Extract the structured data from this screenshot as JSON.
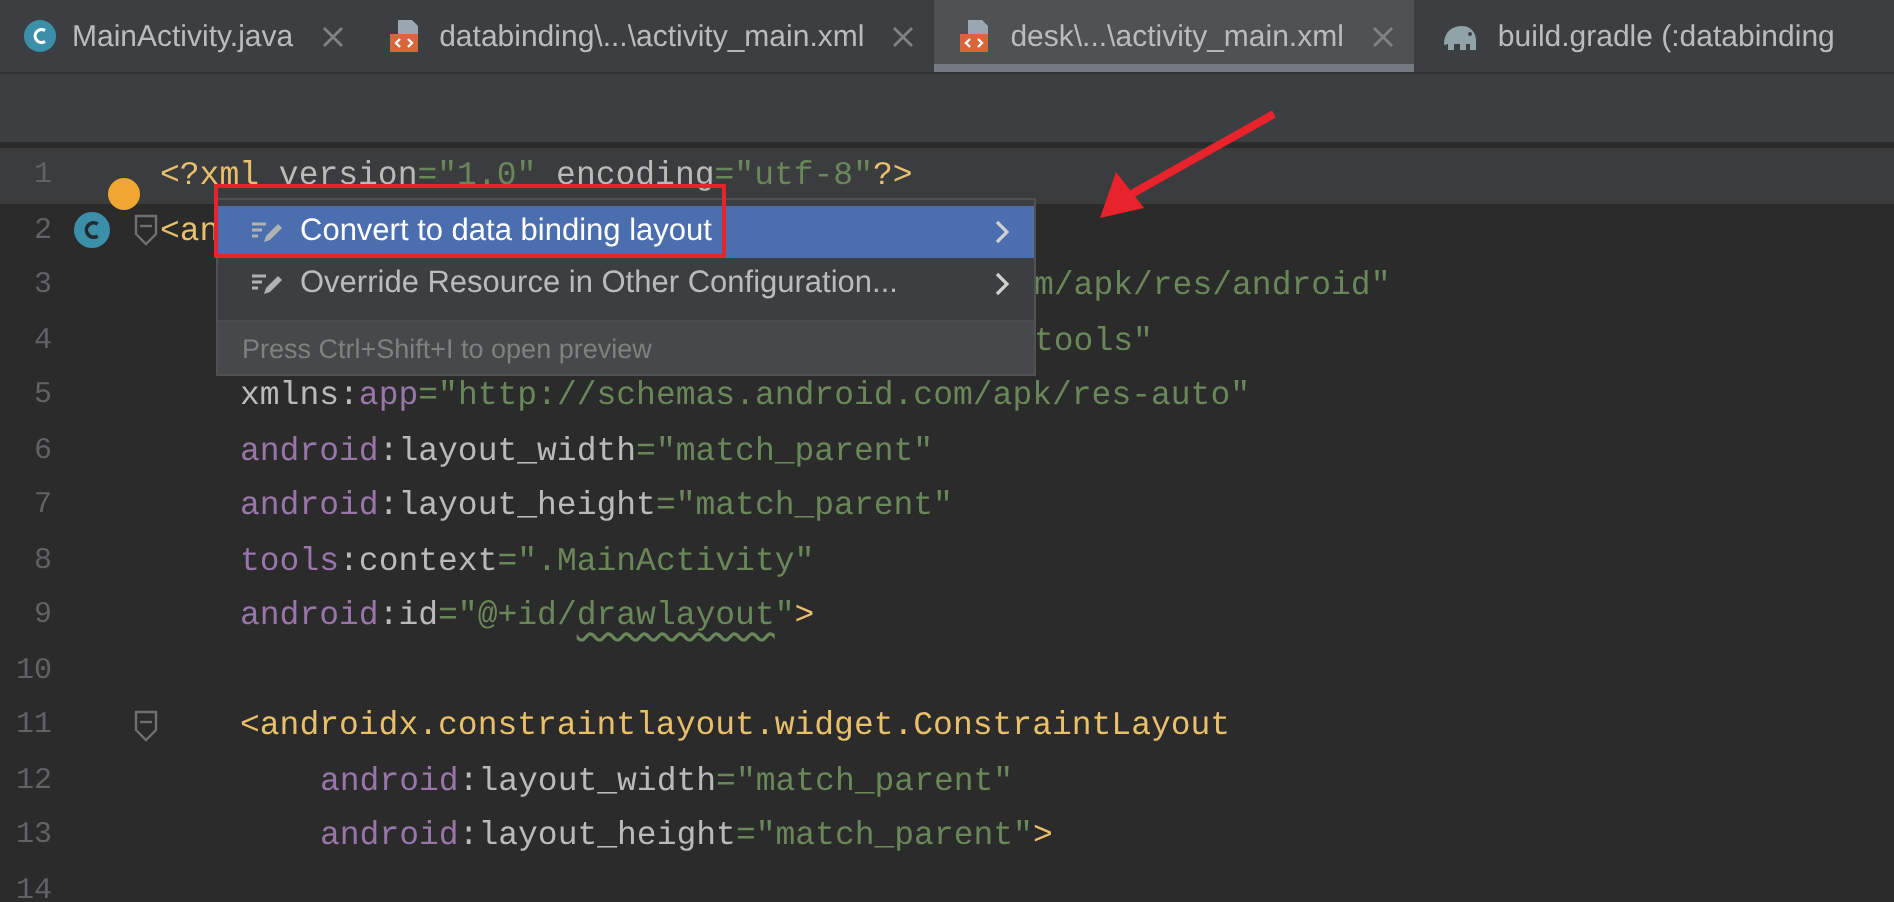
{
  "tabs": [
    {
      "label": "MainActivity.java",
      "kind": "java",
      "selected": false,
      "closable": true
    },
    {
      "label": "databinding\\...\\activity_main.xml",
      "kind": "xml",
      "selected": false,
      "closable": true
    },
    {
      "label": "desk\\...\\activity_main.xml",
      "kind": "xml",
      "selected": true,
      "closable": true
    },
    {
      "label": "build.gradle (:databinding",
      "kind": "gradle",
      "selected": false,
      "closable": false
    }
  ],
  "editor": {
    "lines": [
      {
        "number": "1",
        "current": true,
        "tokens": [
          {
            "kind": "tag",
            "text": "<?xml "
          },
          {
            "kind": "attr",
            "text": "version"
          },
          {
            "kind": "str",
            "text": "=\"1.0\" "
          },
          {
            "kind": "attr",
            "text": "encoding"
          },
          {
            "kind": "str",
            "text": "=\"utf-8\""
          },
          {
            "kind": "tag",
            "text": "?>"
          }
        ]
      },
      {
        "number": "2",
        "class_marker": true,
        "fold": true,
        "bulb": true,
        "tokens": [
          {
            "kind": "tag",
            "text": "<an"
          }
        ]
      },
      {
        "number": "3",
        "kind": "covered",
        "tokens": [
          {
            "kind": "str",
            "text": "m/apk/res/android\""
          }
        ]
      },
      {
        "number": "4",
        "kind": "covered",
        "tokens": [
          {
            "kind": "str",
            "text": "tools\""
          }
        ]
      },
      {
        "number": "5",
        "kind": "attribute",
        "tokens": [
          {
            "kind": "attr",
            "text": "xmlns:"
          },
          {
            "kind": "ns",
            "text": "app"
          },
          {
            "kind": "str",
            "text": "=\"http://schemas.android.com/apk/res-auto\""
          }
        ]
      },
      {
        "number": "6",
        "kind": "attribute",
        "tokens": [
          {
            "kind": "ns",
            "text": "android"
          },
          {
            "kind": "attr",
            "text": ":layout_width"
          },
          {
            "kind": "str",
            "text": "=\"match_parent\""
          }
        ]
      },
      {
        "number": "7",
        "kind": "attribute",
        "tokens": [
          {
            "kind": "ns",
            "text": "android"
          },
          {
            "kind": "attr",
            "text": ":layout_height"
          },
          {
            "kind": "str",
            "text": "=\"match_parent\""
          }
        ]
      },
      {
        "number": "8",
        "kind": "attribute",
        "tokens": [
          {
            "kind": "ns",
            "text": "tools"
          },
          {
            "kind": "attr",
            "text": ":context"
          },
          {
            "kind": "str",
            "text": "=\".MainActivity\""
          }
        ]
      },
      {
        "number": "9",
        "kind": "attribute",
        "tokens": [
          {
            "kind": "ns",
            "text": "android"
          },
          {
            "kind": "attr",
            "text": ":id"
          },
          {
            "kind": "str",
            "text": "=\"@+id/"
          },
          {
            "kind": "str",
            "text": "drawlayout",
            "typo": true
          },
          {
            "kind": "str",
            "text": "\""
          },
          {
            "kind": "tag",
            "text": ">"
          }
        ]
      },
      {
        "number": "10"
      },
      {
        "number": "11",
        "kind": "attribute",
        "fold": true,
        "tokens": [
          {
            "kind": "tag",
            "text": "<androidx.constraintlayout.widget.ConstraintLayout"
          }
        ]
      },
      {
        "number": "12",
        "kind": "nested",
        "tokens": [
          {
            "kind": "ns",
            "text": "android"
          },
          {
            "kind": "attr",
            "text": ":layout_width"
          },
          {
            "kind": "str",
            "text": "=\"match_parent\""
          }
        ]
      },
      {
        "number": "13",
        "kind": "nested",
        "tokens": [
          {
            "kind": "ns",
            "text": "android"
          },
          {
            "kind": "attr",
            "text": ":layout_height"
          },
          {
            "kind": "str",
            "text": "=\"match_parent\""
          },
          {
            "kind": "tag",
            "text": ">"
          }
        ]
      },
      {
        "number": "14"
      }
    ]
  },
  "popup": {
    "items": [
      {
        "label": "Convert to data binding layout",
        "selected": true,
        "submenu": true
      },
      {
        "label": "Override Resource in Other Configuration...",
        "selected": false,
        "submenu": true
      }
    ],
    "hint": "Press Ctrl+Shift+I to open preview"
  }
}
